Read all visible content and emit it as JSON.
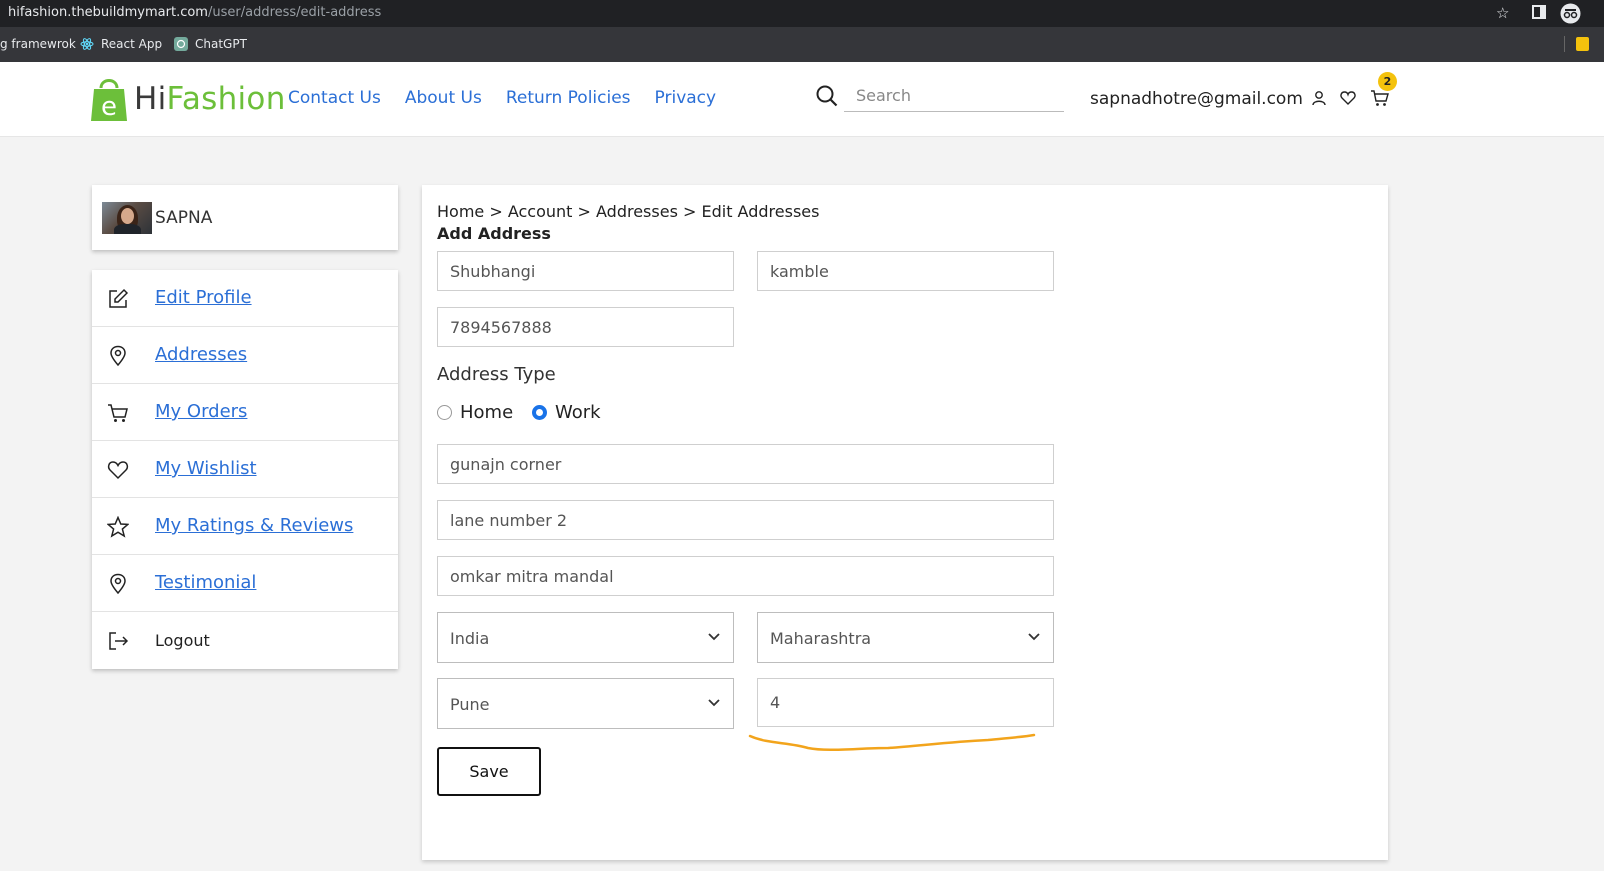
{
  "browser": {
    "url_host": "hifashion.thebuildmymart.com",
    "url_path": "/user/address/edit-address",
    "bookmarks": [
      "g framewrok",
      "React App",
      "ChatGPT"
    ]
  },
  "header": {
    "logo_hi": "Hi",
    "logo_fashion": "Fashion",
    "nav": [
      "Contact Us",
      "About Us",
      "Return Policies",
      "Privacy"
    ],
    "search_placeholder": "Search",
    "user_email": "sapnadhotre@gmail.com",
    "cart_count": "2"
  },
  "sidebar": {
    "username": "SAPNA",
    "items": [
      {
        "label": "Edit Profile",
        "icon": "edit-icon"
      },
      {
        "label": "Addresses",
        "icon": "location-pin-icon"
      },
      {
        "label": "My Orders",
        "icon": "cart-icon"
      },
      {
        "label": "My Wishlist",
        "icon": "heart-icon"
      },
      {
        "label": "My Ratings & Reviews",
        "icon": "star-icon"
      },
      {
        "label": "Testimonial",
        "icon": "location-pin-icon"
      },
      {
        "label": "Logout",
        "icon": "logout-icon"
      }
    ]
  },
  "form": {
    "breadcrumb": "Home > Account > Addresses > Edit Addresses",
    "title": "Add Address",
    "first_name": "Shubhangi",
    "last_name": "kamble",
    "phone": "7894567888",
    "address_type_label": "Address Type",
    "address_type_options": [
      "Home",
      "Work"
    ],
    "address_type_selected": "Work",
    "address_line1": "gunajn corner",
    "address_line2": "lane number 2",
    "landmark": "omkar mitra mandal",
    "country": "India",
    "state": "Maharashtra",
    "city": "Pune",
    "pincode": "4",
    "save_label": "Save"
  },
  "colors": {
    "accent_blue": "#2b6fd6",
    "brand_green": "#6cbf3a",
    "badge_yellow": "#f4c20d",
    "annotation_orange": "#f2a41c"
  }
}
